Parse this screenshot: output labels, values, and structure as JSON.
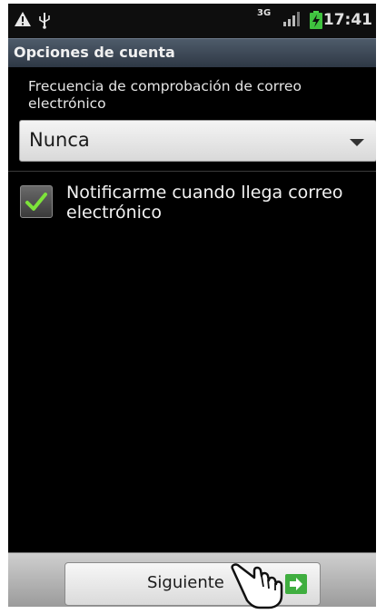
{
  "status_bar": {
    "warning_icon": "warning-triangle-icon",
    "usb_icon": "usb-icon",
    "network_label": "3G",
    "signal_icon": "signal-bars-icon",
    "battery_icon": "battery-charging-icon",
    "time": "17:41"
  },
  "title": "Opciones de cuenta",
  "frequency": {
    "label": "Frecuencia de comprobación de correo electrónico",
    "selected": "Nunca"
  },
  "notify": {
    "label": "Notificarme cuando llega correo electrónico",
    "checked": true
  },
  "footer": {
    "next_label": "Siguiente",
    "next_icon": "arrow-right-icon",
    "cursor_icon": "hand-pointer-icon"
  },
  "colors": {
    "accent_green": "#3fae3f",
    "title_bar": "#3e4a58"
  }
}
